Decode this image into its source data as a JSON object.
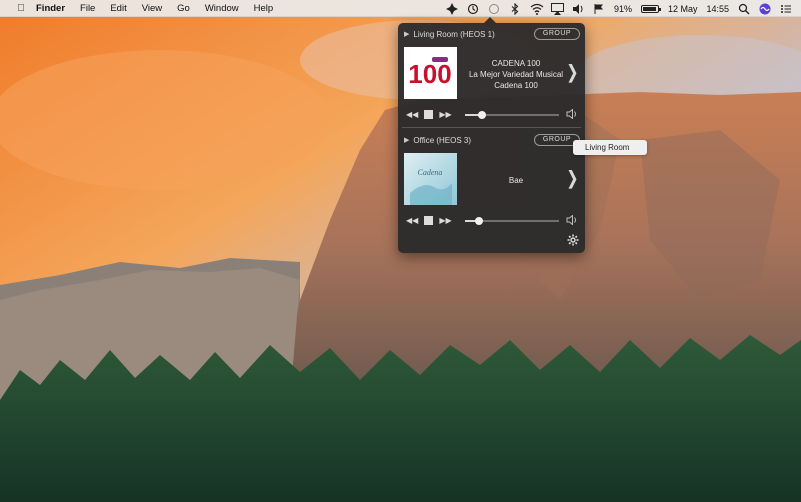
{
  "menubar": {
    "app_name": "Finder",
    "items": [
      "File",
      "Edit",
      "View",
      "Go",
      "Window",
      "Help"
    ],
    "battery_percent": "91%",
    "battery_level": 0.91,
    "date": "12 May",
    "time": "14:55",
    "icons": [
      "apple-icon",
      "heos-icon",
      "time-machine-icon",
      "bluetooth-icon",
      "wifi-icon",
      "airplay-icon",
      "volume-icon",
      "flag-icon",
      "battery-icon",
      "search-icon",
      "siri-icon",
      "notification-center-icon"
    ]
  },
  "heos": {
    "zones": [
      {
        "name": "Living Room (HEOS 1)",
        "group_label": "GROUP",
        "artwork_text": "100",
        "track_lines": [
          "CADENA 100",
          "La Mejor Variedad Musical",
          "Cadena 100"
        ],
        "volume": 0.18
      },
      {
        "name": "Office (HEOS 3)",
        "group_label": "GROUP",
        "artwork_text": "Cadena",
        "track_lines": [
          "Bae"
        ],
        "volume": 0.15
      }
    ],
    "tooltip": "Living Room"
  },
  "colors": {
    "panel_bg": "#28282a",
    "cadena_red": "#c8102e",
    "cadena_purple": "#8a2a8a"
  }
}
